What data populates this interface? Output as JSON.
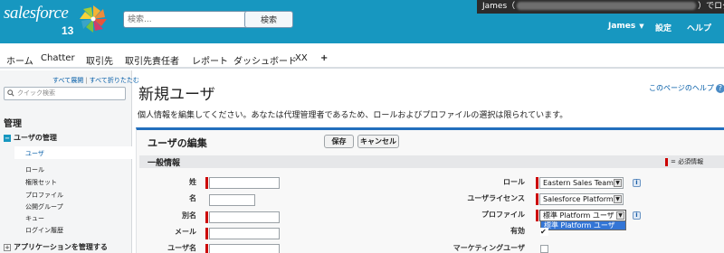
{
  "header": {
    "logo_text": "salesforce",
    "release": "13",
    "search_placeholder": "検索...",
    "search_button": "検索",
    "login_prefix": "James（",
    "login_suffix": "）でログインしています",
    "user_name": "James",
    "settings": "設定",
    "help": "ヘルプ",
    "colors": {
      "bar": "#1797c0",
      "notice": "#2c2c2c"
    }
  },
  "tabs": [
    "ホーム",
    "Chatter",
    "取引先",
    "取引先責任者",
    "レポート",
    "ダッシュボード",
    "XX",
    "+"
  ],
  "sidebar": {
    "expand_all": "すべて展開",
    "collapse_all": "すべて折りたたむ",
    "quick_find_placeholder": "クイック検索",
    "heading": "管理",
    "section_user_mgmt": "ユーザの管理",
    "items": [
      "ユーザ",
      "ロール",
      "権限セット",
      "プロファイル",
      "公開グループ",
      "キュー",
      "ログイン履歴"
    ],
    "section_app_mgmt": "アプリケーションを管理する"
  },
  "main": {
    "title": "新規ユーザ",
    "help_link": "このページのヘルプ",
    "intro": "個人情報を編集してください。あなたは代理管理者であるため、ロールおよびプロファイルの選択は限られています。",
    "panel_title": "ユーザの編集",
    "save": "保存",
    "cancel": "キャンセル",
    "section_title": "一般情報",
    "required_legend": "= 必須情報",
    "fields": {
      "last_name": "姓",
      "first_name": "名",
      "alias": "別名",
      "email": "メール",
      "username": "ユーザ名",
      "role": "ロール",
      "user_license": "ユーザライセンス",
      "profile": "プロファイル",
      "active": "有効",
      "marketing_user": "マーケティングユーザ"
    },
    "values": {
      "role": "Eastern Sales Team",
      "user_license": "Salesforce Platform",
      "profile": "標準 Platform ユーザ",
      "profile_option": "標準 Platform ユーザ"
    }
  }
}
